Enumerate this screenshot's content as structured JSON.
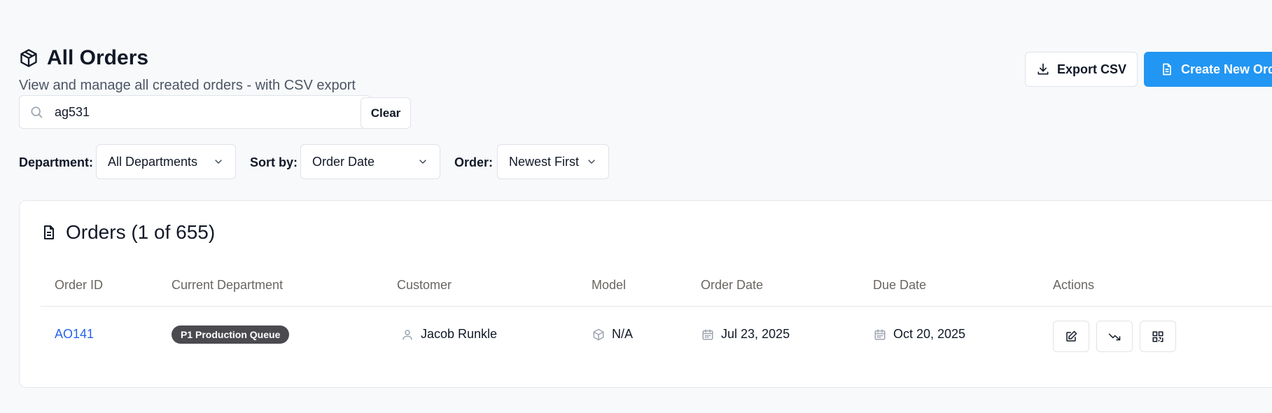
{
  "header": {
    "title": "All Orders",
    "subtitle": "View and manage all created orders - with CSV export",
    "export_label": "Export CSV",
    "create_label": "Create New Order"
  },
  "search": {
    "value": "ag531",
    "clear_label": "Clear"
  },
  "filters": {
    "department_label": "Department:",
    "department_value": "All Departments",
    "sort_label": "Sort by:",
    "sort_value": "Order Date",
    "order_label": "Order:",
    "order_value": "Newest First"
  },
  "orders": {
    "title": "Orders (1 of 655)",
    "columns": [
      "Order ID",
      "Current Department",
      "Customer",
      "Model",
      "Order Date",
      "Due Date",
      "Actions"
    ],
    "rows": [
      {
        "order_id": "AO141",
        "department": "P1 Production Queue",
        "customer": "Jacob Runkle",
        "model": "N/A",
        "order_date": "Jul 23, 2025",
        "due_date": "Oct 20, 2025"
      }
    ]
  },
  "icons": {
    "title": "package-icon",
    "search": "search-icon",
    "export": "download-icon",
    "create": "file-icon",
    "orders": "document-icon",
    "customer": "user-icon",
    "model": "package-icon",
    "date": "calendar-icon",
    "edit": "edit-icon",
    "trend": "trending-down-icon",
    "qr": "qr-code-icon",
    "chevron": "chevron-down-icon"
  },
  "colors": {
    "accent": "#2196f3",
    "link": "#2563eb",
    "badge": "#4b4b4f",
    "background": "#f8f9fb"
  }
}
